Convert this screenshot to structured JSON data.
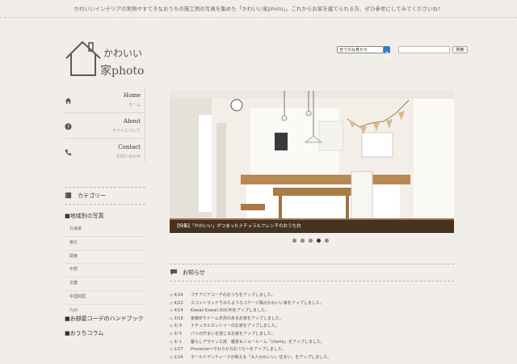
{
  "header": {
    "intro": "かわいいインテリアの実例やすてきなおうちの施工例の写真を集めた「かわいい家photo」。これからお家を建てられる方、ぜひ参考にしてみてくださいね！"
  },
  "logo": {
    "kana": "かわいい",
    "main": "家photo"
  },
  "search": {
    "scope": "全ての写真から",
    "button": "検索",
    "placeholder": ""
  },
  "nav": [
    {
      "en": "Home",
      "jp": "ホーム",
      "icon": "home-icon"
    },
    {
      "en": "About",
      "jp": "サイトについて",
      "icon": "question-icon"
    },
    {
      "en": "Contact",
      "jp": "お問い合わせ",
      "icon": "phone-icon"
    }
  ],
  "sidebar": {
    "category_title": "カテゴリー",
    "regional_title": "■地域別の写真",
    "regions": [
      "北海道",
      "東北",
      "関東",
      "中部",
      "近畿",
      "中国四国",
      "九州"
    ],
    "handbook_title": "■お部屋コーデのハンドブック",
    "column_title": "■おうちコラム"
  },
  "hero": {
    "caption": "【特集】「かわいい」がつまったナチュラルフレンチのおうち白"
  },
  "slider": {
    "count": 5,
    "active": 3
  },
  "news": {
    "title": "お知らせ",
    "items": [
      {
        "date": "◇ 4/24",
        "text": "ブチアジアコーデのおうちをアップしました。"
      },
      {
        "date": "◇ 4/22",
        "text": "スコットランドでみたようなコテージ風のかわいい家をアップしました。"
      },
      {
        "date": "◇ 4/14",
        "text": "Kawaii Kawaii OUCHIをアップしました。"
      },
      {
        "date": "◇ 3/18",
        "text": "後暖炉りドーム天井のあるお家をアップしました。"
      },
      {
        "date": "◇ 3/ 9",
        "text": "ナチュラルカントリーのお家をアップしました。"
      },
      {
        "date": "◇ 3/ 5",
        "text": "パリの佇まいを感じるお家をアップしました。"
      },
      {
        "date": "◇ 3/ 1",
        "text": "暮らしデザイン工房　雑貨＆ショールーム「cherté」をアップしました。"
      },
      {
        "date": "◇ 2/27",
        "text": "Provence～やわらかなおうち～をアップしました。"
      },
      {
        "date": "◇ 2/24",
        "text": "オールドアンティークが映える「大人かわいい」住まい、をアップしました。"
      }
    ]
  }
}
